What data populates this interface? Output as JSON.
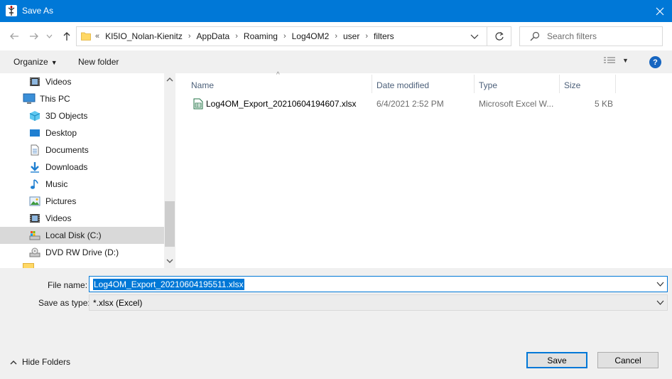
{
  "window": {
    "title": "Save As"
  },
  "address": {
    "overflow": "«",
    "crumbs": [
      "KI5IO_Nolan-Kienitz",
      "AppData",
      "Roaming",
      "Log4OM2",
      "user",
      "filters"
    ]
  },
  "search": {
    "placeholder": "Search filters"
  },
  "toolbar": {
    "organize": "Organize",
    "new_folder": "New folder"
  },
  "tree": {
    "items": [
      {
        "label": "Videos",
        "icon": "videos-icon"
      },
      {
        "label": "This PC",
        "icon": "pc-icon"
      },
      {
        "label": "3D Objects",
        "icon": "3d-objects-icon"
      },
      {
        "label": "Desktop",
        "icon": "desktop-icon"
      },
      {
        "label": "Documents",
        "icon": "documents-icon"
      },
      {
        "label": "Downloads",
        "icon": "downloads-icon"
      },
      {
        "label": "Music",
        "icon": "music-icon"
      },
      {
        "label": "Pictures",
        "icon": "pictures-icon"
      },
      {
        "label": "Videos",
        "icon": "videos-icon"
      },
      {
        "label": "Local Disk (C:)",
        "icon": "local-disk-icon"
      },
      {
        "label": "DVD RW Drive (D:)",
        "icon": "dvd-drive-icon"
      }
    ],
    "selected": "Local Disk (C:)"
  },
  "columns": {
    "name": "Name",
    "date": "Date modified",
    "type": "Type",
    "size": "Size"
  },
  "files": [
    {
      "name": "Log4OM_Export_20210604194607.xlsx",
      "date": "6/4/2021 2:52 PM",
      "type": "Microsoft Excel W...",
      "size": "5 KB"
    }
  ],
  "form": {
    "file_name_label": "File name:",
    "file_name_value": "Log4OM_Export_20210604195511.xlsx",
    "save_type_label": "Save as type:",
    "save_type_value": "*.xlsx (Excel)"
  },
  "buttons": {
    "save": "Save",
    "cancel": "Cancel",
    "hide_folders": "Hide Folders",
    "help": "?"
  },
  "colors": {
    "accent": "#0078d7",
    "chrome": "#f0f0f0"
  }
}
